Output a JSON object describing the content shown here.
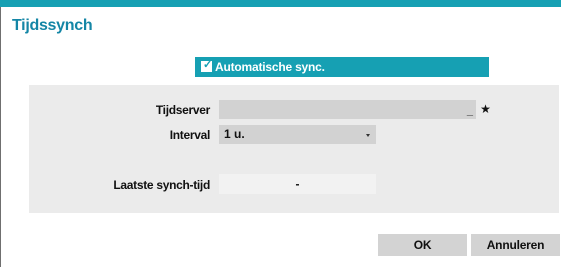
{
  "dialog": {
    "title": "Tijdssynch",
    "accent_color": "#16a0b3",
    "title_color": "#1486a6"
  },
  "auto_sync": {
    "label": "Automatische sync.",
    "checked": true
  },
  "fields": {
    "time_server": {
      "label": "Tijdserver",
      "value": "",
      "suffix": "_",
      "button_icon": "star-icon",
      "button_glyph": "★"
    },
    "interval": {
      "label": "Interval",
      "value": "1 u."
    },
    "last_sync": {
      "label": "Laatste synch-tijd",
      "value": "-"
    }
  },
  "buttons": {
    "ok_label": "OK",
    "cancel_label": "Annuleren"
  }
}
